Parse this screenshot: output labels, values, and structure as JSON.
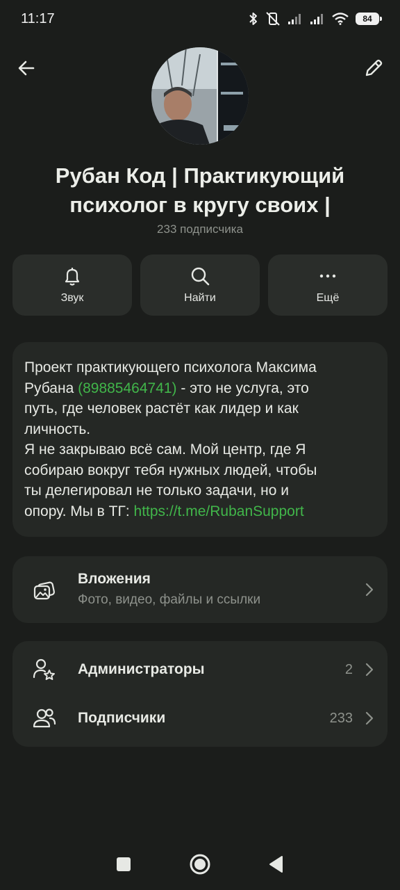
{
  "status": {
    "time": "11:17",
    "battery": "84"
  },
  "channel": {
    "title_line1": "Рубан Код | Практикующий",
    "title_line2": "психолог в кругу своих |",
    "subscribers_text": "233 подписчика"
  },
  "actions": [
    {
      "label": "Звук",
      "icon": "bell-icon"
    },
    {
      "label": "Найти",
      "icon": "search-icon"
    },
    {
      "label": "Ещё",
      "icon": "more-icon"
    }
  ],
  "about": {
    "line1": "Проект практикующего психолога Максима",
    "line2_pre": "Рубана ",
    "phone": "(89885464741)",
    "line2_post": " -  это не услуга, это",
    "line3": "путь, где человек растёт как лидер и как",
    "line4": "личность.",
    "line5": "Я не закрываю всё сам. Мой центр, где Я",
    "line6": "собираю вокруг тебя нужных людей, чтобы",
    "line7": "ты делегировал не только задачи, но и",
    "line8_pre": "опору. Мы в ТГ: ",
    "link": "https://t.me/RubanSupport"
  },
  "attachments": {
    "title": "Вложения",
    "subtitle": "Фото, видео, файлы и ссылки"
  },
  "members": {
    "admins_label": "Администраторы",
    "admins_count": "2",
    "subscribers_label": "Подписчики",
    "subscribers_count": "233"
  },
  "colors": {
    "accent_link": "#41b64a",
    "background": "#1b1d1b",
    "card": "#252825"
  }
}
